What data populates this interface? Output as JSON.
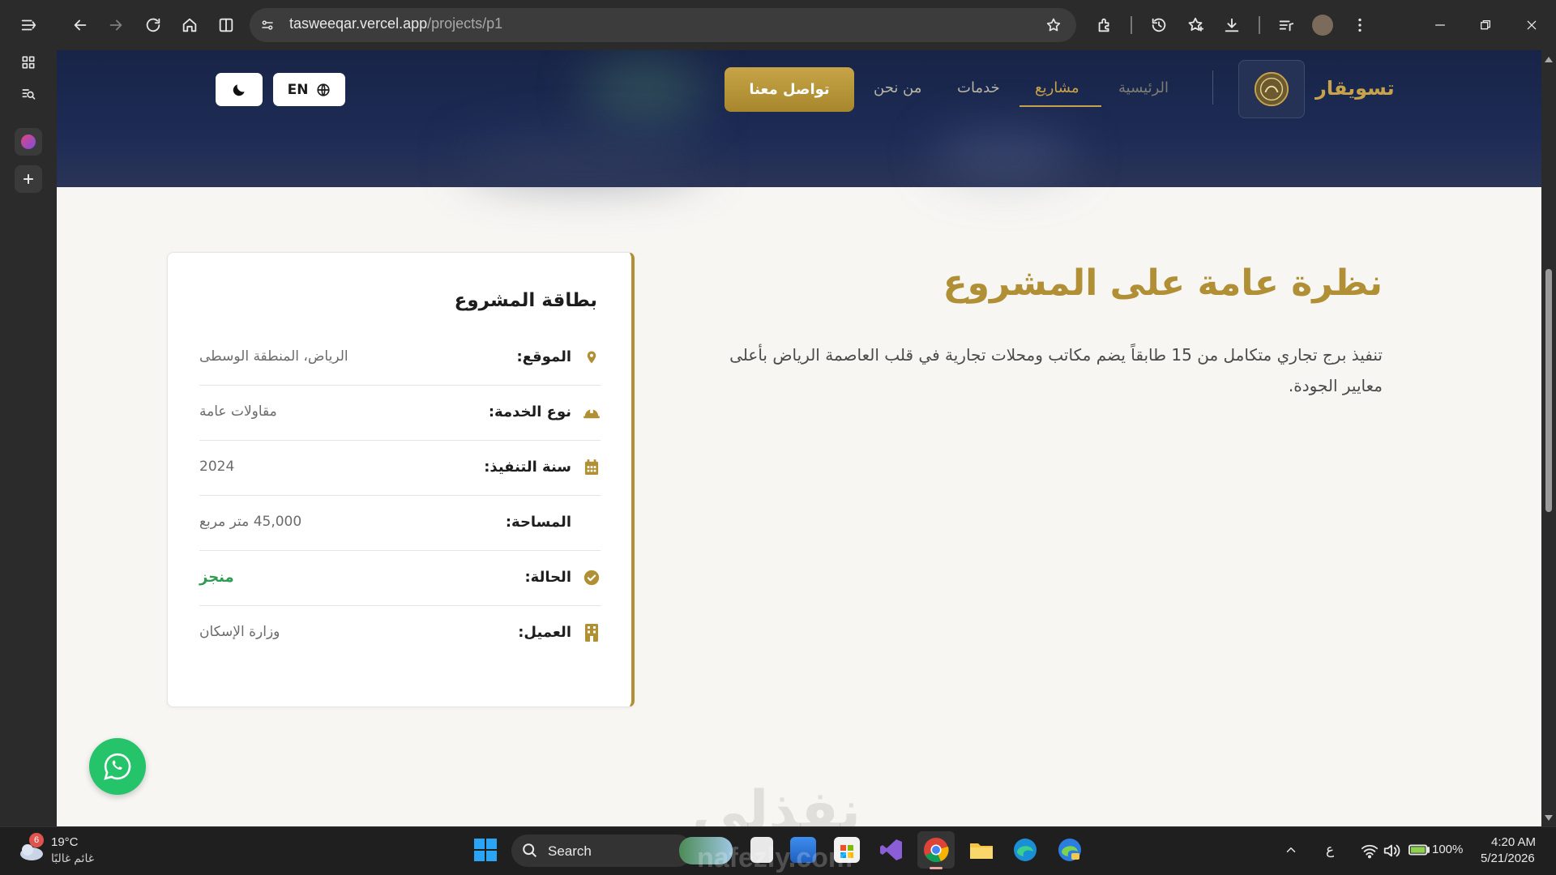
{
  "browser": {
    "url_host": "tasweeqar.vercel.app",
    "url_path": "/projects/p1"
  },
  "nav": {
    "brand": "تسويقار",
    "links": [
      "الرئيسية",
      "مشاريع",
      "خدمات",
      "من نحن"
    ],
    "active_link": "مشاريع",
    "contact_button": "تواصل معنا",
    "language_button": "EN"
  },
  "overview": {
    "title": "نظرة عامة على المشروع",
    "description": "تنفيذ برج تجاري متكامل من 15 طابقاً يضم مكاتب ومحلات تجارية في قلب العاصمة الرياض بأعلى معايير الجودة."
  },
  "project_card": {
    "title": "بطاقة المشروع",
    "rows": [
      {
        "label": "الموقع:",
        "value": "الرياض، المنطقة الوسطى",
        "icon": "location-pin-icon"
      },
      {
        "label": "نوع الخدمة:",
        "value": "مقاولات عامة",
        "icon": "hard-hat-icon"
      },
      {
        "label": "سنة التنفيذ:",
        "value": "2024",
        "icon": "calendar-icon"
      },
      {
        "label": "المساحة:",
        "value": "45,000 متر مربع",
        "icon": "area-icon"
      },
      {
        "label": "الحالة:",
        "value": "منجز",
        "icon": "check-circle-icon"
      },
      {
        "label": "العميل:",
        "value": "وزارة الإسكان",
        "icon": "building-icon"
      }
    ]
  },
  "watermark": {
    "arabic": "نفذلي",
    "latin": "nafezly.com"
  },
  "taskbar": {
    "weather_temp": "19°C",
    "weather_desc": "غائم غالبًا",
    "weather_badge": "6",
    "search_label": "Search",
    "input_lang": "ع",
    "battery": "100%",
    "time": "4:20 AM",
    "date": "5/21/2026"
  },
  "colors": {
    "gold": "#b08f35",
    "navy": "#1d2b55",
    "status_green": "#2e9a52",
    "whatsapp": "#25c46a"
  }
}
